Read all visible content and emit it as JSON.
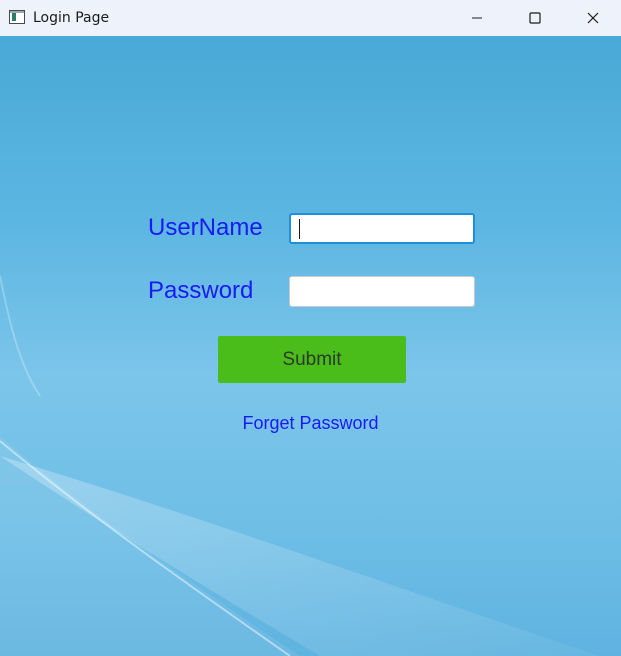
{
  "window": {
    "title": "Login Page",
    "icons": {
      "app": "app-window-icon",
      "minimize": "minimize-icon",
      "maximize": "maximize-icon",
      "close": "close-icon"
    }
  },
  "form": {
    "username_label": "UserName",
    "username_value": "",
    "password_label": "Password",
    "password_value": "",
    "submit_label": "Submit",
    "forget_link": "Forget Password"
  },
  "colors": {
    "label_text": "#1a1af2",
    "submit_bg": "#4bbd1a",
    "focus_border": "#1e8fd8",
    "background": "#5cb6e2",
    "titlebar": "#eef2fb"
  }
}
